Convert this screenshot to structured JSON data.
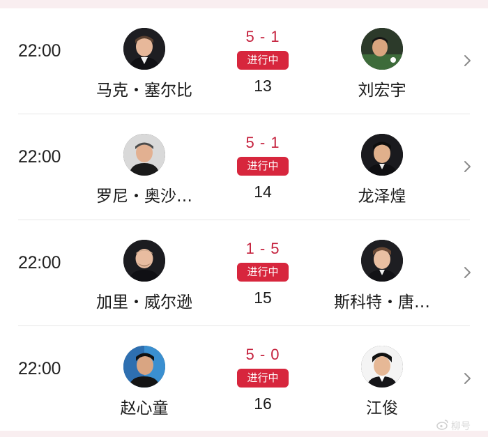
{
  "matches": [
    {
      "time": "22:00",
      "player1": {
        "name": "马克・塞尔比"
      },
      "score": "5 - 1",
      "status": "进行中",
      "match_no": "13",
      "player2": {
        "name": "刘宏宇"
      }
    },
    {
      "time": "22:00",
      "player1": {
        "name": "罗尼・奥沙…"
      },
      "score": "5 - 1",
      "status": "进行中",
      "match_no": "14",
      "player2": {
        "name": "龙泽煌"
      }
    },
    {
      "time": "22:00",
      "player1": {
        "name": "加里・威尔逊"
      },
      "score": "1 - 5",
      "status": "进行中",
      "match_no": "15",
      "player2": {
        "name": "斯科特・唐…"
      }
    },
    {
      "time": "22:00",
      "player1": {
        "name": "赵心童"
      },
      "score": "5 - 0",
      "status": "进行中",
      "match_no": "16",
      "player2": {
        "name": "江俊"
      }
    }
  ],
  "watermark": {
    "text": "柳号",
    "icon": "weibo-icon"
  },
  "colors": {
    "accent": "#d7263d",
    "score": "#c5213d",
    "background": "#f9eef0"
  }
}
